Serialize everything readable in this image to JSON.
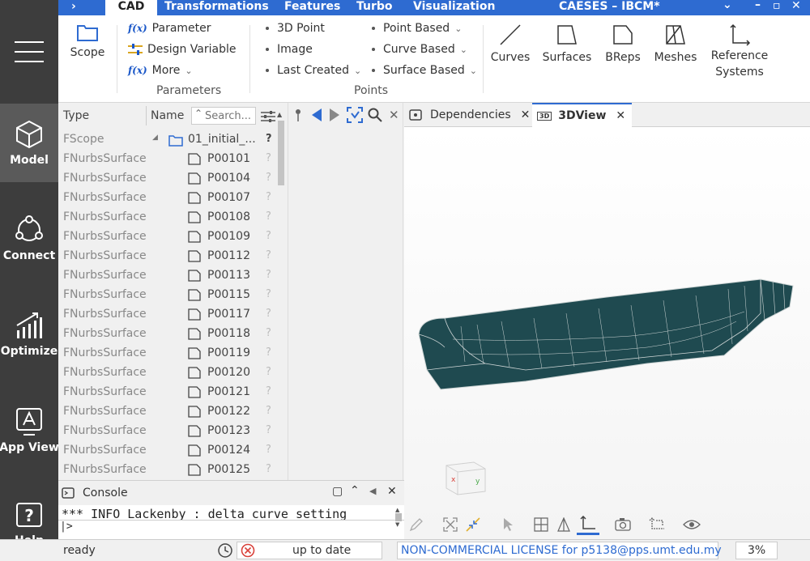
{
  "window": {
    "title": "CAESES – IBCM*"
  },
  "ribbon_tabs": [
    "CAD",
    "Transformations",
    "Features",
    "Turbo",
    "Visualization"
  ],
  "nav": [
    {
      "label": "Model"
    },
    {
      "label": "Connect"
    },
    {
      "label": "Optimize"
    },
    {
      "label": "App View"
    },
    {
      "label": "Help"
    }
  ],
  "ribbon": {
    "scope": "Scope",
    "parameters": {
      "parameter": "Parameter",
      "design_variable": "Design Variable",
      "more": "More",
      "group": "Parameters"
    },
    "points": {
      "p3d": "3D Point",
      "image": "Image",
      "last_created": "Last Created",
      "point_based": "Point Based",
      "curve_based": "Curve Based",
      "surface_based": "Surface Based",
      "group": "Points"
    },
    "big": {
      "curves": "Curves",
      "surfaces": "Surfaces",
      "breps": "BReps",
      "meshes": "Meshes",
      "ref1": "Reference",
      "ref2": "Systems"
    }
  },
  "tree": {
    "col_type": "Type",
    "col_name": "Name",
    "search_placeholder": "Search...",
    "root": {
      "type": "FScope",
      "name": "01_initial_...",
      "status": "?"
    },
    "rows": [
      {
        "type": "FNurbsSurface",
        "name": "P00101",
        "status": "?"
      },
      {
        "type": "FNurbsSurface",
        "name": "P00104",
        "status": "?"
      },
      {
        "type": "FNurbsSurface",
        "name": "P00107",
        "status": "?"
      },
      {
        "type": "FNurbsSurface",
        "name": "P00108",
        "status": "?"
      },
      {
        "type": "FNurbsSurface",
        "name": "P00109",
        "status": "?"
      },
      {
        "type": "FNurbsSurface",
        "name": "P00112",
        "status": "?"
      },
      {
        "type": "FNurbsSurface",
        "name": "P00113",
        "status": "?"
      },
      {
        "type": "FNurbsSurface",
        "name": "P00115",
        "status": "?"
      },
      {
        "type": "FNurbsSurface",
        "name": "P00117",
        "status": "?"
      },
      {
        "type": "FNurbsSurface",
        "name": "P00118",
        "status": "?"
      },
      {
        "type": "FNurbsSurface",
        "name": "P00119",
        "status": "?"
      },
      {
        "type": "FNurbsSurface",
        "name": "P00120",
        "status": "?"
      },
      {
        "type": "FNurbsSurface",
        "name": "P00121",
        "status": "?"
      },
      {
        "type": "FNurbsSurface",
        "name": "P00122",
        "status": "?"
      },
      {
        "type": "FNurbsSurface",
        "name": "P00123",
        "status": "?"
      },
      {
        "type": "FNurbsSurface",
        "name": "P00124",
        "status": "?"
      },
      {
        "type": "FNurbsSurface",
        "name": "P00125",
        "status": "?"
      }
    ]
  },
  "view_tabs": {
    "dependencies": "Dependencies",
    "view3d": "3DView",
    "view3d_badge": "3D"
  },
  "console": {
    "title": "Console",
    "last_line": "*** INFO Lackenby : delta curve setting",
    "prompt": "|>"
  },
  "status": {
    "left": "ready",
    "state": "up to date",
    "license": "NON-COMMERCIAL LICENSE for p5138@pps.umt.edu.my",
    "percent": "3%"
  },
  "colors": {
    "accent": "#2e6bd1",
    "nav_bg": "#3d3d3d",
    "hull": "#1f4a50"
  },
  "axis_cube": {
    "x": "x",
    "y": "y"
  }
}
